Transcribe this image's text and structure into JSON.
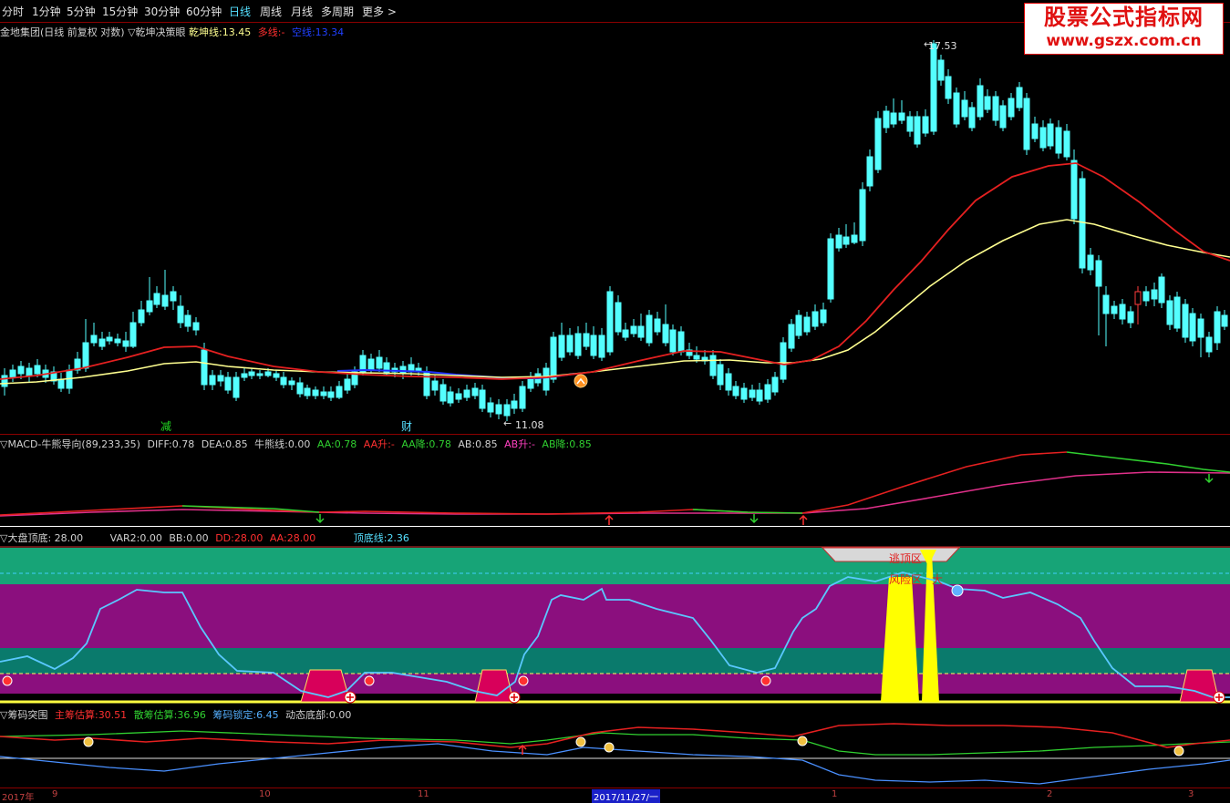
{
  "toolbar": {
    "items": [
      "分时",
      "1分钟",
      "5分钟",
      "15分钟",
      "30分钟",
      "60分钟",
      "日线",
      "周线",
      "月线",
      "多周期",
      "更多 >"
    ],
    "active_index": 6
  },
  "watermark": {
    "line1": "股票公式指标网",
    "line2": "www.gszx.com.cn"
  },
  "main_panel": {
    "title": "金地集团(日线 前复权 对数) ▽乾坤决策眼",
    "qiankun_label": "乾坤线:",
    "qiankun_value": "13.45",
    "duo_label": "多线:",
    "duo_value": "-",
    "kong_label": "空线:",
    "kong_value": "13.34",
    "high_label": "17.53",
    "low_label": "11.08",
    "marker_jian": "减",
    "marker_cai": "财"
  },
  "macd_panel": {
    "title": "▽MACD-牛熊导向(89,233,35)",
    "diff_label": "DIFF:",
    "diff_value": "0.78",
    "dea_label": "DEA:",
    "dea_value": "0.85",
    "niu_label": "牛熊线:",
    "niu_value": "0.00",
    "aa_label": "AA:",
    "aa_value": "0.78",
    "aa_up_label": "AA升:",
    "aa_up_value": "-",
    "aa_down_label": "AA降:",
    "aa_down_value": "0.78",
    "ab_label": "AB:",
    "ab_value": "0.85",
    "ab_up_label": "AB升:",
    "ab_up_value": "-",
    "ab_down_label": "AB降:",
    "ab_down_value": "0.85"
  },
  "dapan_panel": {
    "title": "▽大盘顶底",
    "title_value": ": 28.00",
    "var2_label": "VAR2:",
    "var2_value": "0.00",
    "bb_label": "BB:",
    "bb_value": "0.00",
    "dd_label": "DD:",
    "dd_value": "28.00",
    "aa_label": "AA:",
    "aa_value": "28.00",
    "ding_label": "顶底线:",
    "ding_value": "2.36",
    "tag_top": "逃顶区",
    "tag_risk": "风险区",
    "tag_big": "大"
  },
  "chouma_panel": {
    "title": "▽筹码突围",
    "zhu_label": "主筹估算:",
    "zhu_value": "30.51",
    "san_label": "散筹估算:",
    "san_value": "36.96",
    "suo_label": "筹码锁定:",
    "suo_value": "6.45",
    "dong_label": "动态底部:",
    "dong_value": "0.00"
  },
  "date_axis": {
    "labels": [
      "2017年",
      "9",
      "10",
      "11",
      "1",
      "2",
      "3"
    ],
    "current": "2017/11/27/一"
  },
  "colors": {
    "up": "#ff3b3b",
    "down": "#54ffff",
    "ma_red": "#e52020",
    "ma_yellow": "#ffff90",
    "ma_blue": "#2030ff",
    "band_green": "#17a477",
    "band_purple": "#8b0f7e",
    "band_teal": "#0a7a6c",
    "alert_yellow": "#ffff00"
  }
}
